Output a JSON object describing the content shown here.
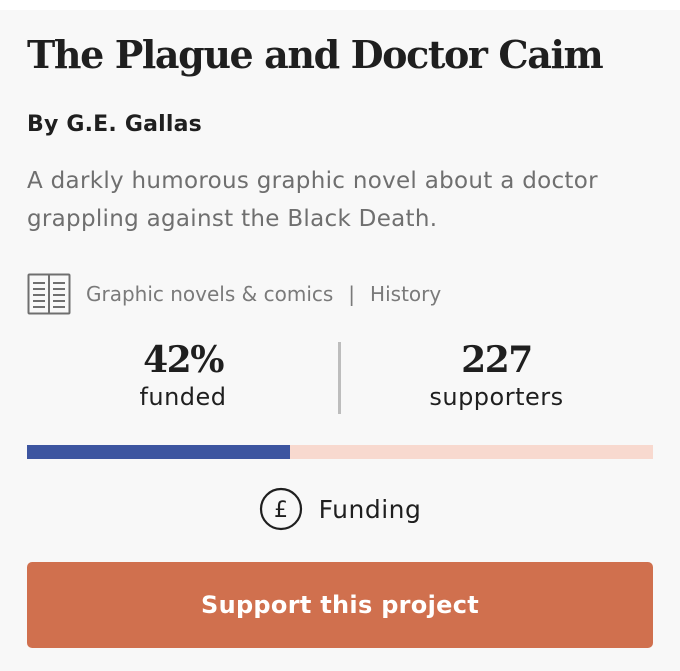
{
  "project": {
    "title": "The Plague and Doctor Caim",
    "author": "By G.E. Gallas",
    "description": "A darkly humorous graphic novel about a doctor grappling against the Black Death.",
    "category": "Graphic novels & comics",
    "separator": "|",
    "subcategory": "History",
    "category_icon": "book-icon"
  },
  "stats": {
    "funded_value": "42%",
    "funded_label": "funded",
    "funded_fraction": 0.42,
    "supporters_value": "227",
    "supporters_label": "supporters"
  },
  "funding": {
    "icon": "pound-icon",
    "label": "Funding"
  },
  "cta": {
    "label": "Support this project"
  },
  "colors": {
    "progress_fill": "#3d55a0",
    "progress_track": "#f8d9cf",
    "button": "#d0704e"
  }
}
